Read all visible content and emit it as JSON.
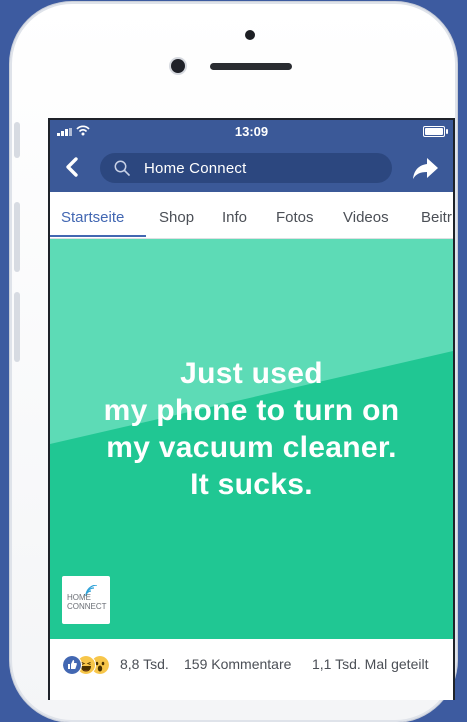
{
  "status_bar": {
    "time": "13:09"
  },
  "header": {
    "search_text": "Home Connect"
  },
  "tabs": [
    {
      "label": "Startseite",
      "active": true
    },
    {
      "label": "Shop"
    },
    {
      "label": "Info"
    },
    {
      "label": "Fotos"
    },
    {
      "label": "Videos"
    },
    {
      "label": "Beitr"
    }
  ],
  "post": {
    "lines": [
      "Just used",
      "my phone to turn on",
      "my vacuum cleaner.",
      "It sucks."
    ],
    "logo": {
      "line1": "HOME",
      "line2": "CONNECT"
    },
    "colors": {
      "light": "#5ddbb6",
      "dark": "#20c793",
      "accent": "#4267b2"
    }
  },
  "stats": {
    "reactions": [
      "like-icon",
      "haha-icon",
      "wow-icon"
    ],
    "reaction_count": "8,8 Tsd.",
    "comments": "159 Kommentare",
    "shares": "1,1 Tsd. Mal geteilt"
  }
}
